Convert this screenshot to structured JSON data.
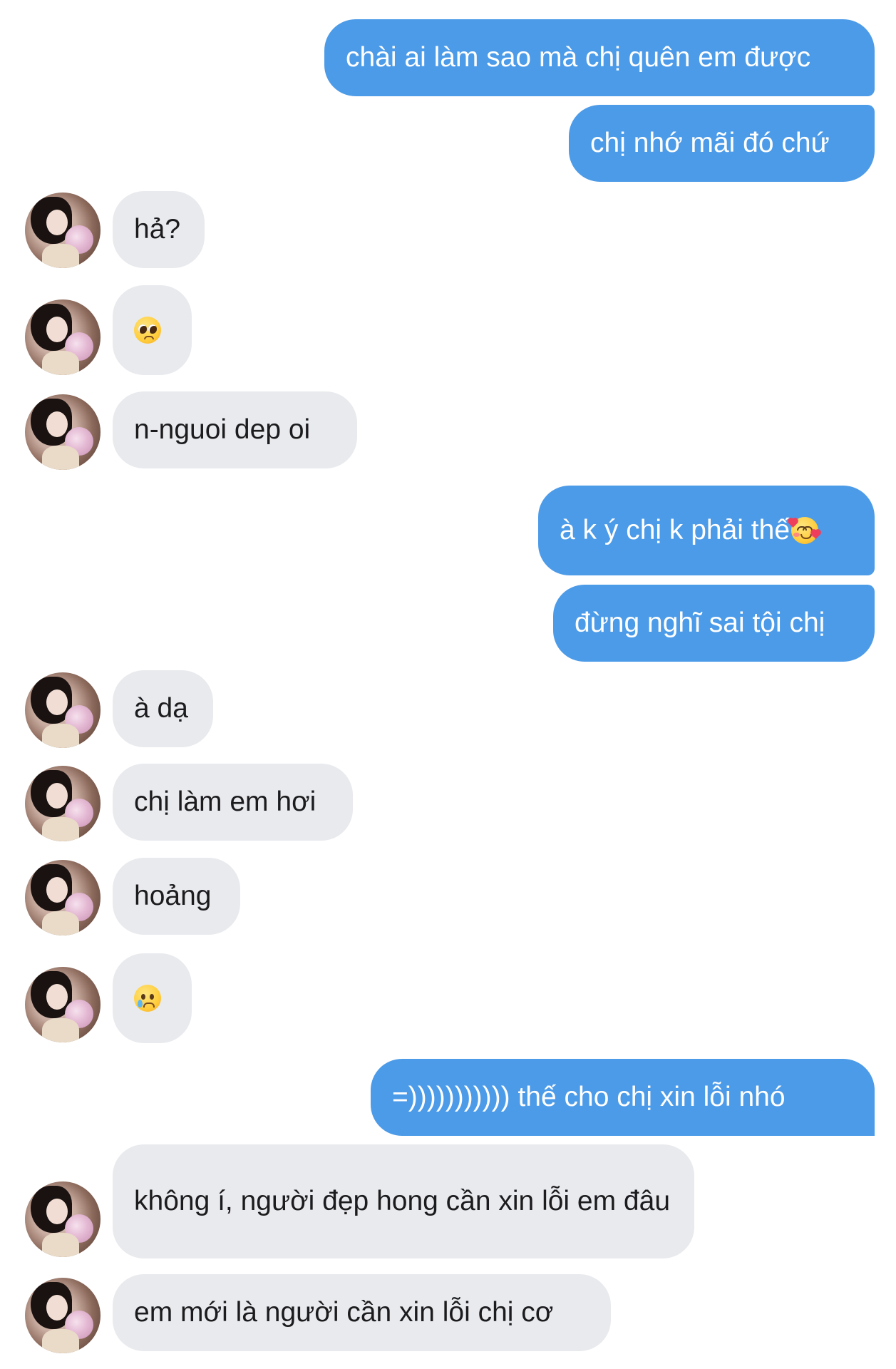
{
  "conversation": {
    "messages": [
      {
        "id": "m1",
        "side": "sent",
        "text": "chài ai làm sao mà chị quên em được"
      },
      {
        "id": "m2",
        "side": "sent",
        "text": "chị nhớ mãi đó chứ"
      },
      {
        "id": "m3",
        "side": "received",
        "text": "hả?"
      },
      {
        "id": "m4",
        "side": "received",
        "text": "",
        "emoji": "pleading-face-emoji"
      },
      {
        "id": "m5",
        "side": "received",
        "text": "n-nguoi dep oi"
      },
      {
        "id": "m6",
        "side": "sent",
        "text": "à k ý chị k phải thế",
        "emoji": "smiling-face-with-hearts-emoji"
      },
      {
        "id": "m7",
        "side": "sent",
        "text": "đừng nghĩ sai tội chị"
      },
      {
        "id": "m8",
        "side": "received",
        "text": "à dạ"
      },
      {
        "id": "m9",
        "side": "received",
        "text": "chị làm em hơi"
      },
      {
        "id": "m10",
        "side": "received",
        "text": "hoảng"
      },
      {
        "id": "m11",
        "side": "received",
        "text": "",
        "emoji": "crying-face-emoji"
      },
      {
        "id": "m12",
        "side": "sent",
        "text": "=))))))))))) thế cho chị xin lỗi nhó"
      },
      {
        "id": "m13",
        "side": "received",
        "text": "không í, người đẹp hong cần xin lỗi em đâu"
      },
      {
        "id": "m14",
        "side": "received",
        "text": "em mới là người cần xin lỗi chị cơ"
      }
    ]
  },
  "colors": {
    "sent_bubble": "#4c9be8",
    "received_bubble": "#e9eaee",
    "sent_text": "#ffffff",
    "received_text": "#1c1c1e",
    "background": "#ffffff"
  }
}
